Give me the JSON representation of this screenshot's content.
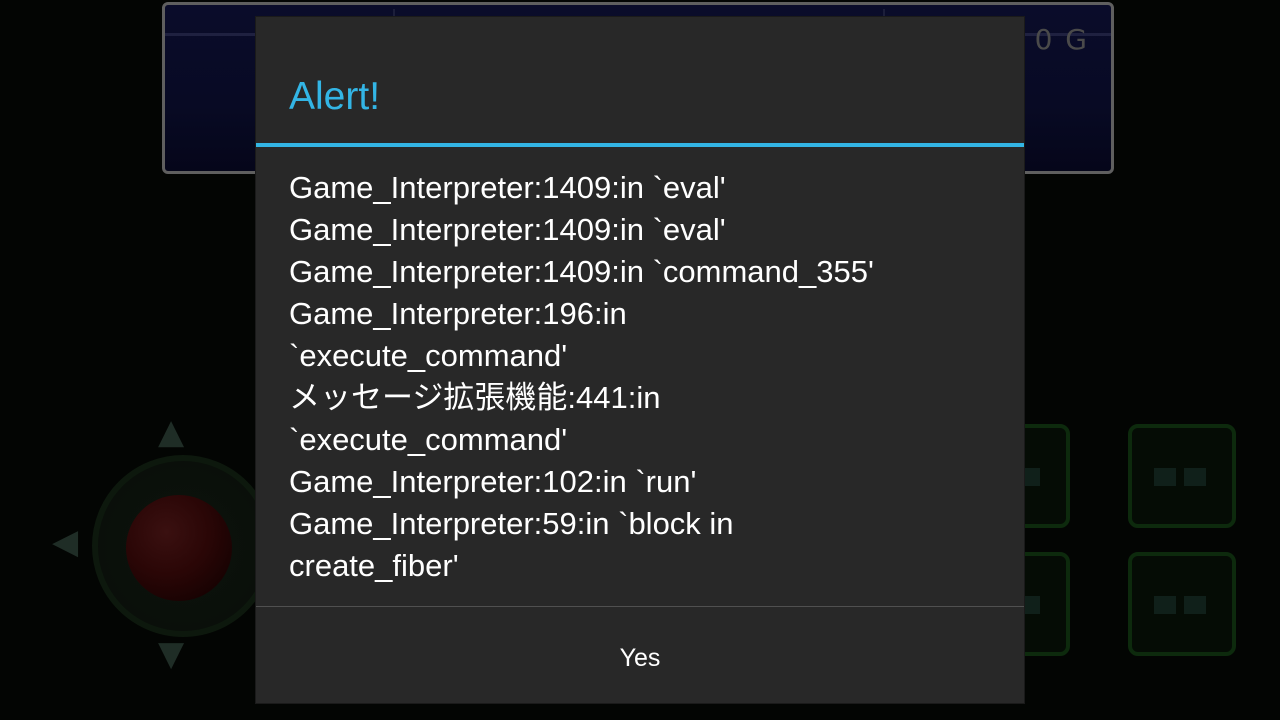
{
  "background": {
    "status_window": {
      "gold_text": "0 G"
    },
    "dpad_arrows": {
      "up": "▲",
      "down": "▼",
      "left": "◀"
    }
  },
  "dialog": {
    "title": "Alert!",
    "message_lines": [
      "Game_Interpreter:1409:in `eval'",
      "Game_Interpreter:1409:in `eval'",
      "Game_Interpreter:1409:in `command_355'",
      "Game_Interpreter:196:in",
      "`execute_command'",
      "メッセージ拡張機能:441:in",
      "`execute_command'",
      "Game_Interpreter:102:in `run'",
      "Game_Interpreter:59:in `block in",
      "create_fiber'"
    ],
    "positive_button": "Yes",
    "accent_color": "#33b5e5"
  }
}
